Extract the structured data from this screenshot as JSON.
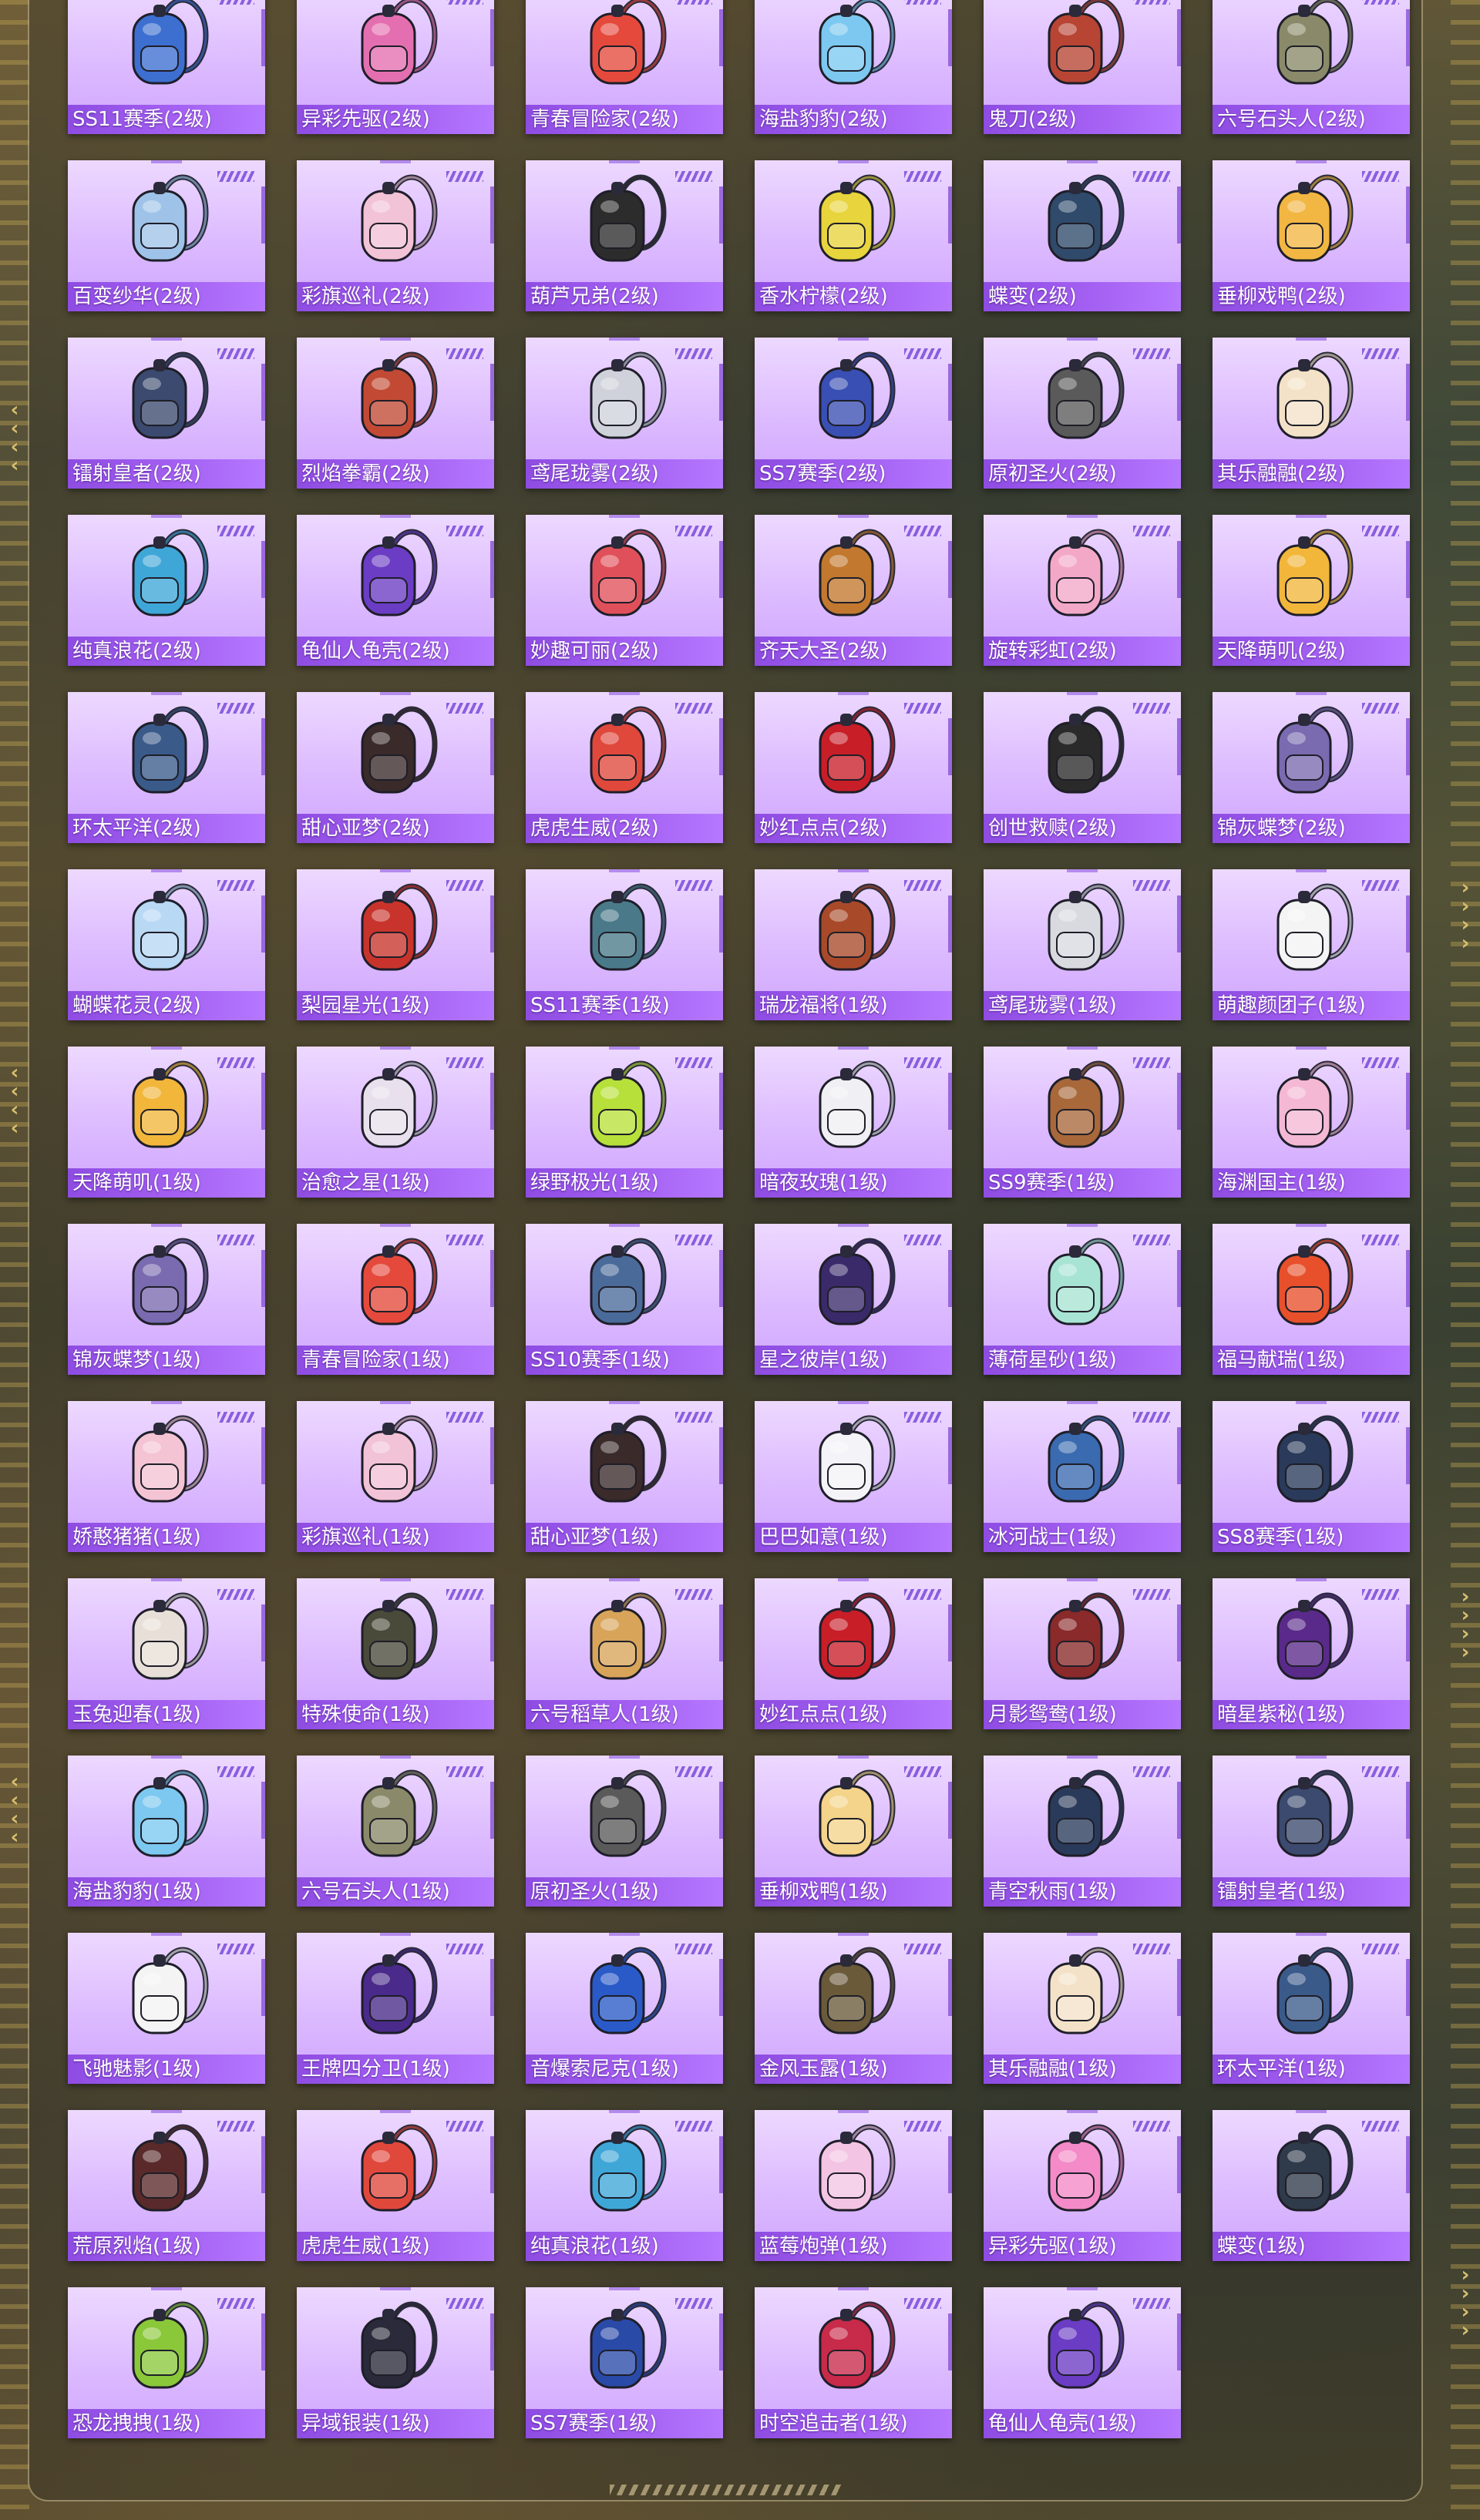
{
  "items": [
    {
      "label": "SS11赛季(2级)",
      "icon": "backpack-icon",
      "color": "#3d6fd0"
    },
    {
      "label": "异彩先驱(2级)",
      "icon": "backpack-icon",
      "color": "#e46fb0"
    },
    {
      "label": "青春冒险家(2级)",
      "icon": "backpack-icon",
      "color": "#e5493c"
    },
    {
      "label": "海盐豹豹(2级)",
      "icon": "backpack-icon",
      "color": "#7cc8f0"
    },
    {
      "label": "鬼刀(2级)",
      "icon": "backpack-icon",
      "color": "#b84434"
    },
    {
      "label": "六号石头人(2级)",
      "icon": "backpack-icon",
      "color": "#8a8a6a"
    },
    {
      "label": "百变纱华(2级)",
      "icon": "backpack-icon",
      "color": "#9fc3e8"
    },
    {
      "label": "彩旗巡礼(2级)",
      "icon": "backpack-icon",
      "color": "#f2c2d6"
    },
    {
      "label": "葫芦兄弟(2级)",
      "icon": "backpack-icon",
      "color": "#2c2c2c"
    },
    {
      "label": "香水柠檬(2级)",
      "icon": "backpack-icon",
      "color": "#e8d43c"
    },
    {
      "label": "蝶变(2级)",
      "icon": "backpack-icon",
      "color": "#2f4a6a"
    },
    {
      "label": "垂柳戏鸭(2级)",
      "icon": "backpack-icon",
      "color": "#f2b642"
    },
    {
      "label": "镭射皇者(2级)",
      "icon": "backpack-icon",
      "color": "#3b4a6e"
    },
    {
      "label": "烈焰拳霸(2级)",
      "icon": "backpack-icon",
      "color": "#c24a34"
    },
    {
      "label": "鸢尾珑雾(2级)",
      "icon": "backpack-icon",
      "color": "#cfd2da"
    },
    {
      "label": "SS7赛季(2级)",
      "icon": "backpack-icon",
      "color": "#3a4fb4"
    },
    {
      "label": "原初圣火(2级)",
      "icon": "backpack-icon",
      "color": "#5a5a5a"
    },
    {
      "label": "其乐融融(2级)",
      "icon": "backpack-icon",
      "color": "#f4e2c8"
    },
    {
      "label": "纯真浪花(2级)",
      "icon": "backpack-icon",
      "color": "#3fa7d8"
    },
    {
      "label": "龟仙人龟壳(2级)",
      "icon": "backpack-icon",
      "color": "#6b3cc4"
    },
    {
      "label": "妙趣可丽(2级)",
      "icon": "backpack-icon",
      "color": "#e0505a"
    },
    {
      "label": "齐天大圣(2级)",
      "icon": "backpack-icon",
      "color": "#c2782e"
    },
    {
      "label": "旋转彩虹(2级)",
      "icon": "backpack-icon",
      "color": "#f4a8c8"
    },
    {
      "label": "天降萌叽(2级)",
      "icon": "backpack-icon",
      "color": "#f2b63a"
    },
    {
      "label": "环太平洋(2级)",
      "icon": "backpack-icon",
      "color": "#3a5a8a"
    },
    {
      "label": "甜心亚梦(2级)",
      "icon": "backpack-icon",
      "color": "#3a2a2a"
    },
    {
      "label": "虎虎生威(2级)",
      "icon": "backpack-icon",
      "color": "#e0483c"
    },
    {
      "label": "妙红点点(2级)",
      "icon": "backpack-icon",
      "color": "#c81e28"
    },
    {
      "label": "创世救赎(2级)",
      "icon": "backpack-icon",
      "color": "#2a2a2a"
    },
    {
      "label": "锦灰蝶梦(2级)",
      "icon": "backpack-icon",
      "color": "#7a6ab0"
    },
    {
      "label": "蝴蝶花灵(2级)",
      "icon": "backpack-icon",
      "color": "#b8d8f4"
    },
    {
      "label": "梨园星光(1级)",
      "icon": "backpack-icon",
      "color": "#c8342c"
    },
    {
      "label": "SS11赛季(1级)",
      "icon": "backpack-icon",
      "color": "#4a7a8a"
    },
    {
      "label": "瑞龙福将(1级)",
      "icon": "backpack-icon",
      "color": "#a84a2a"
    },
    {
      "label": "鸢尾珑雾(1级)",
      "icon": "backpack-icon",
      "color": "#d8dae0"
    },
    {
      "label": "萌趣颜团子(1级)",
      "icon": "backpack-icon",
      "color": "#f4f4f4"
    },
    {
      "label": "天降萌叽(1级)",
      "icon": "backpack-icon",
      "color": "#f2b63a"
    },
    {
      "label": "治愈之星(1级)",
      "icon": "backpack-icon",
      "color": "#e8e0ec"
    },
    {
      "label": "绿野极光(1级)",
      "icon": "backpack-icon",
      "color": "#b8e03a"
    },
    {
      "label": "暗夜玫瑰(1级)",
      "icon": "backpack-icon",
      "color": "#f0f0f4"
    },
    {
      "label": "SS9赛季(1级)",
      "icon": "backpack-icon",
      "color": "#a8683a"
    },
    {
      "label": "海渊国主(1级)",
      "icon": "backpack-icon",
      "color": "#f4b8d4"
    },
    {
      "label": "锦灰蝶梦(1级)",
      "icon": "backpack-icon",
      "color": "#7a6ab0"
    },
    {
      "label": "青春冒险家(1级)",
      "icon": "backpack-icon",
      "color": "#e5493c"
    },
    {
      "label": "SS10赛季(1级)",
      "icon": "backpack-icon",
      "color": "#4a6a9a"
    },
    {
      "label": "星之彼岸(1级)",
      "icon": "backpack-icon",
      "color": "#3a2a6a"
    },
    {
      "label": "薄荷星砂(1级)",
      "icon": "backpack-icon",
      "color": "#a8e4d4"
    },
    {
      "label": "福马献瑞(1级)",
      "icon": "backpack-icon",
      "color": "#e8502c"
    },
    {
      "label": "娇憨猪猪(1级)",
      "icon": "backpack-icon",
      "color": "#f4c4d4"
    },
    {
      "label": "彩旗巡礼(1级)",
      "icon": "backpack-icon",
      "color": "#f2c2d6"
    },
    {
      "label": "甜心亚梦(1级)",
      "icon": "backpack-icon",
      "color": "#3a2a2a"
    },
    {
      "label": "巴巴如意(1级)",
      "icon": "backpack-icon",
      "color": "#f4f4f8"
    },
    {
      "label": "冰河战士(1级)",
      "icon": "backpack-icon",
      "color": "#3a6ab0"
    },
    {
      "label": "SS8赛季(1级)",
      "icon": "backpack-icon",
      "color": "#2a3a5a"
    },
    {
      "label": "玉兔迎春(1级)",
      "icon": "backpack-icon",
      "color": "#e8e0d8"
    },
    {
      "label": "特殊使命(1级)",
      "icon": "backpack-icon",
      "color": "#4a4a3a"
    },
    {
      "label": "六号稻草人(1级)",
      "icon": "backpack-icon",
      "color": "#d8a45a"
    },
    {
      "label": "妙红点点(1级)",
      "icon": "backpack-icon",
      "color": "#c81e28"
    },
    {
      "label": "月影鸳鸯(1级)",
      "icon": "backpack-icon",
      "color": "#8a2a2a"
    },
    {
      "label": "暗星紫秘(1级)",
      "icon": "backpack-icon",
      "color": "#5a2a8a"
    },
    {
      "label": "海盐豹豹(1级)",
      "icon": "backpack-icon",
      "color": "#7cc8f0"
    },
    {
      "label": "六号石头人(1级)",
      "icon": "backpack-icon",
      "color": "#8a8a6a"
    },
    {
      "label": "原初圣火(1级)",
      "icon": "backpack-icon",
      "color": "#5a5a5a"
    },
    {
      "label": "垂柳戏鸭(1级)",
      "icon": "backpack-icon",
      "color": "#f4d48a"
    },
    {
      "label": "青空秋雨(1级)",
      "icon": "backpack-icon",
      "color": "#2a3a5a"
    },
    {
      "label": "镭射皇者(1级)",
      "icon": "backpack-icon",
      "color": "#3b4a6e"
    },
    {
      "label": "飞驰魅影(1级)",
      "icon": "backpack-icon",
      "color": "#f4f4f4"
    },
    {
      "label": "王牌四分卫(1级)",
      "icon": "backpack-icon",
      "color": "#4a2a8a"
    },
    {
      "label": "音爆索尼克(1级)",
      "icon": "backpack-icon",
      "color": "#2a5ac8"
    },
    {
      "label": "金风玉露(1级)",
      "icon": "backpack-icon",
      "color": "#6a5a3a"
    },
    {
      "label": "其乐融融(1级)",
      "icon": "backpack-icon",
      "color": "#f4e2c8"
    },
    {
      "label": "环太平洋(1级)",
      "icon": "backpack-icon",
      "color": "#3a5a8a"
    },
    {
      "label": "荒原烈焰(1级)",
      "icon": "backpack-icon",
      "color": "#5a2a2a"
    },
    {
      "label": "虎虎生威(1级)",
      "icon": "backpack-icon",
      "color": "#e0483c"
    },
    {
      "label": "纯真浪花(1级)",
      "icon": "backpack-icon",
      "color": "#3fa7d8"
    },
    {
      "label": "蓝莓炮弹(1级)",
      "icon": "backpack-icon",
      "color": "#f4c4e4"
    },
    {
      "label": "异彩先驱(1级)",
      "icon": "backpack-icon",
      "color": "#f48ac8"
    },
    {
      "label": "蝶变(1级)",
      "icon": "backpack-icon",
      "color": "#2f3a4a"
    },
    {
      "label": "恐龙拽拽(1级)",
      "icon": "backpack-icon",
      "color": "#8ac83a"
    },
    {
      "label": "异域银装(1级)",
      "icon": "backpack-icon",
      "color": "#2a2a3a"
    },
    {
      "label": "SS7赛季(1级)",
      "icon": "backpack-icon",
      "color": "#2a4aa8"
    },
    {
      "label": "时空追击者(1级)",
      "icon": "backpack-icon",
      "color": "#c82a4a"
    },
    {
      "label": "龟仙人龟壳(1级)",
      "icon": "backpack-icon",
      "color": "#6b3cc4"
    }
  ]
}
